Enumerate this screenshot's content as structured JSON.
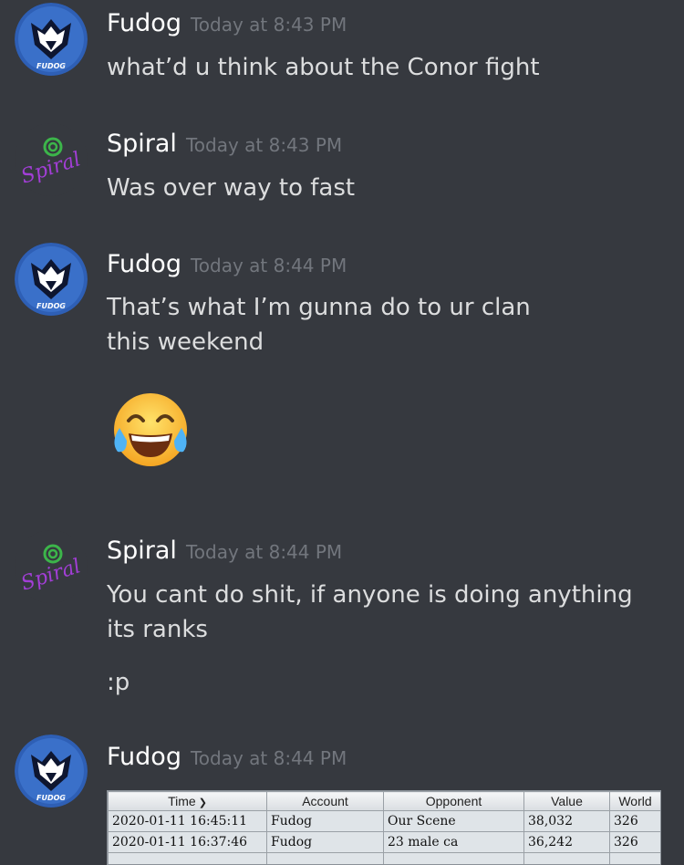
{
  "messages": [
    {
      "username": "Fudog",
      "timestamp": "Today at 8:43 PM",
      "lines": [
        "what’d u think about the Conor fight"
      ]
    },
    {
      "username": "Spiral",
      "timestamp": "Today at 8:43 PM",
      "lines": [
        "Was over way to fast"
      ]
    },
    {
      "username": "Fudog",
      "timestamp": "Today at 8:44 PM",
      "lines": [
        "That’s what I’m gunna do to ur clan this weekend"
      ],
      "emoji": "face-with-tears-of-joy"
    },
    {
      "username": "Spiral",
      "timestamp": "Today at 8:44 PM",
      "lines": [
        "You cant do shit, if anyone is doing anything its ranks",
        ":p"
      ]
    },
    {
      "username": "Fudog",
      "timestamp": "Today at 8:44 PM",
      "attachment": "screenshot-table"
    }
  ],
  "avatars": {
    "fudog_label": "FUDOG",
    "spiral_label": "Spiral"
  },
  "attachment": {
    "columns": [
      "Time",
      "Account",
      "Opponent",
      "Value",
      "World"
    ],
    "rows": [
      [
        "2020-01-11 16:45:11",
        "Fudog",
        "Our Scene",
        "38,032",
        "326"
      ],
      [
        "2020-01-11 16:37:46",
        "Fudog",
        "23 male ca",
        "36,242",
        "326"
      ]
    ]
  },
  "colors": {
    "background": "#36393f",
    "username": "#ffffff",
    "timestamp": "#72767d",
    "text": "#dcddde",
    "spiral_accent": "#a23ed6"
  }
}
